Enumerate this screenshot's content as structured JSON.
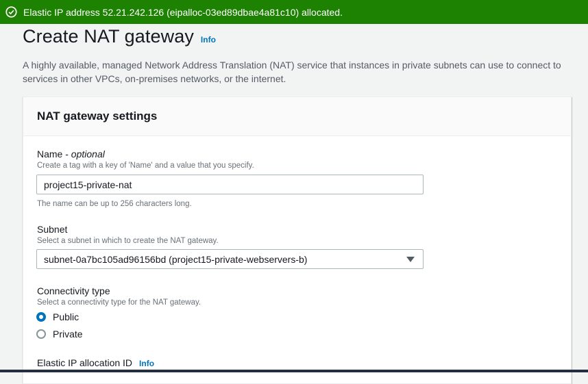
{
  "flash": {
    "message": "Elastic IP address 52.21.242.126 (eipalloc-03ed89dbae4a81c10) allocated.",
    "icon": "check-circle-icon",
    "color": "#1d8102"
  },
  "header": {
    "title": "Create NAT gateway",
    "info": "Info",
    "description": "A highly available, managed Network Address Translation (NAT) service that instances in private subnets can use to connect to services in other VPCs, on-premises networks, or the internet."
  },
  "panel": {
    "title": "NAT gateway settings",
    "name_field": {
      "label": "Name - ",
      "optional": "optional",
      "hint": "Create a tag with a key of 'Name' and a value that you specify.",
      "value": "project15-private-nat",
      "constraint": "The name can be up to 256 characters long."
    },
    "subnet_field": {
      "label": "Subnet",
      "hint": "Select a subnet in which to create the NAT gateway.",
      "selected": "subnet-0a7bc105ad96156bd (project15-private-webservers-b)"
    },
    "connectivity_field": {
      "label": "Connectivity type",
      "hint": "Select a connectivity type for the NAT gateway.",
      "options": [
        {
          "label": "Public",
          "checked": true
        },
        {
          "label": "Private",
          "checked": false
        }
      ]
    },
    "eip_field": {
      "label": "Elastic IP allocation ID",
      "info": "Info"
    }
  }
}
